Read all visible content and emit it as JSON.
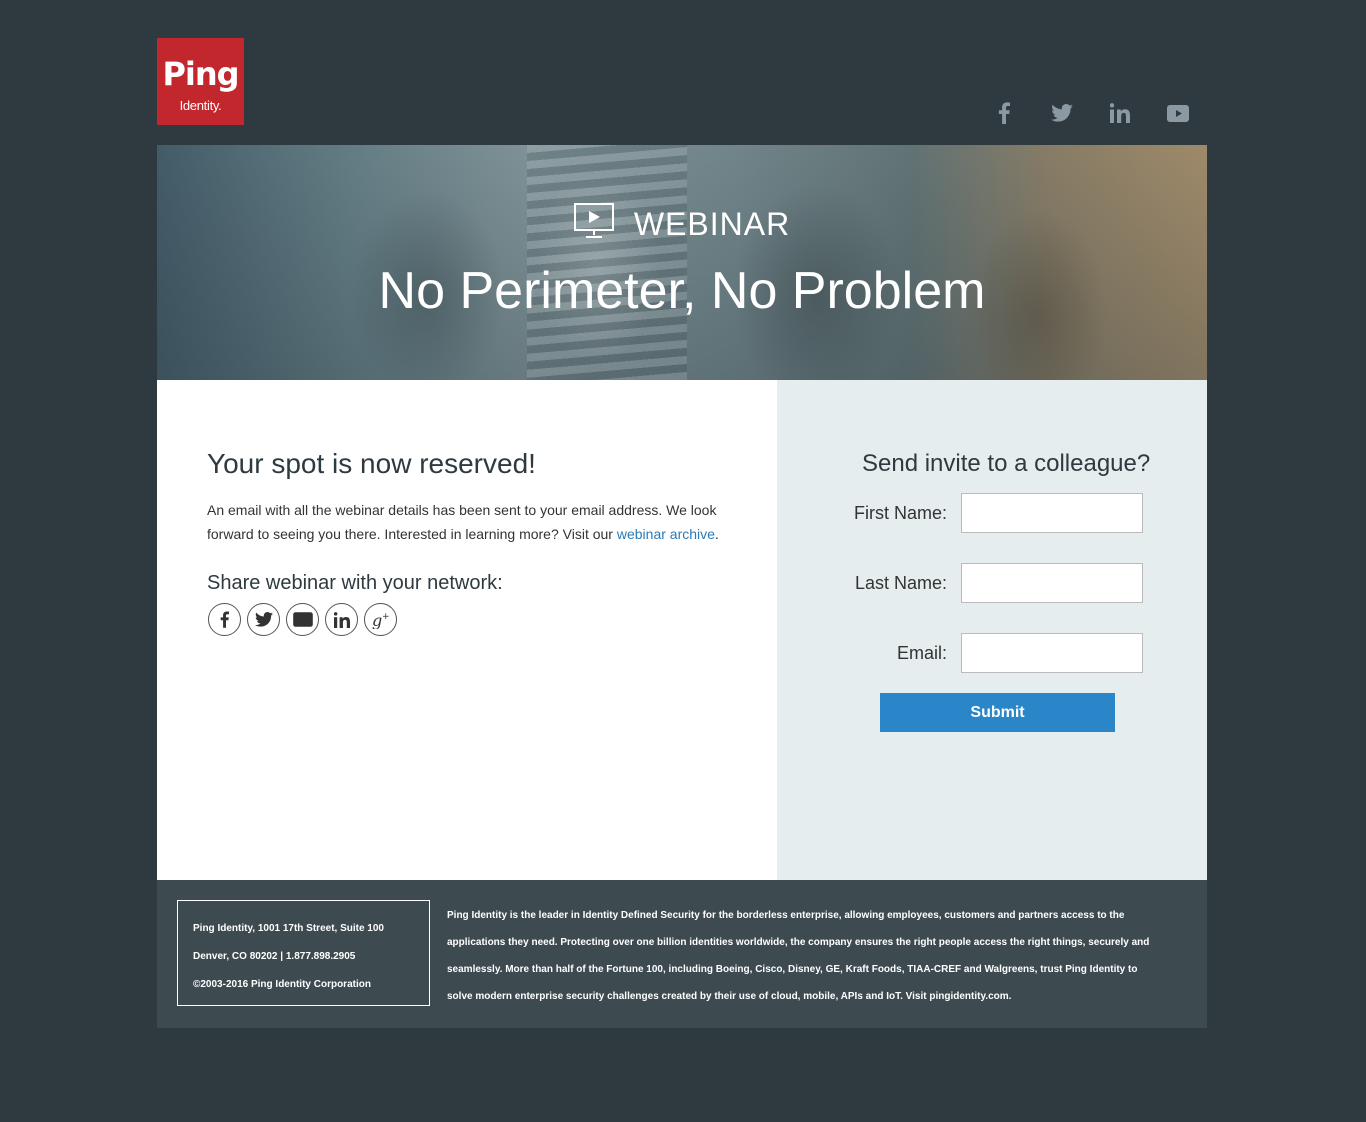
{
  "header": {
    "logo_main": "Ping",
    "logo_sub": "Identity.",
    "social": [
      {
        "icon": "facebook-icon"
      },
      {
        "icon": "twitter-icon"
      },
      {
        "icon": "linkedin-icon"
      },
      {
        "icon": "youtube-icon"
      }
    ]
  },
  "hero": {
    "label": "WEBINAR",
    "title": "No Perimeter, No Problem"
  },
  "confirmation": {
    "heading": "Your spot is now reserved!",
    "body_before_link": "An email with all the webinar details has been sent to your email address. We look forward to seeing you there. Interested in learning more? Visit our ",
    "link_text": "webinar archive",
    "body_after_link": ".",
    "share_title": "Share webinar with your network:",
    "share_icons": [
      "facebook-icon",
      "twitter-icon",
      "email-icon",
      "linkedin-icon",
      "google-plus-icon"
    ]
  },
  "invite": {
    "heading": "Send invite to a colleague?",
    "first_name_label": "First Name:",
    "first_name_value": "",
    "last_name_label": "Last Name:",
    "last_name_value": "",
    "email_label": "Email:",
    "email_value": "",
    "submit_label": "Submit"
  },
  "footer": {
    "address_line1": "Ping Identity, 1001 17th Street, Suite 100",
    "address_line2": "Denver, CO 80202 | 1.877.898.2905",
    "copyright": "©2003-2016 Ping Identity Corporation",
    "about": "Ping Identity is the leader in Identity Defined Security for the borderless enterprise, allowing employees, customers and partners access to the applications they need. Protecting over one billion identities worldwide, the company ensures the right people access the right things, securely and seamlessly. More than half of the Fortune 100, including Boeing, Cisco, Disney, GE, Kraft Foods, TIAA-CREF and Walgreens, trust Ping Identity to solve modern enterprise security challenges created by their use of cloud, mobile, APIs and IoT. Visit pingidentity.com."
  },
  "colors": {
    "page_bg": "#2e3a40",
    "logo_red": "#c1272d",
    "accent_blue": "#2a86c8",
    "link_blue": "#2a7ab8",
    "invite_panel_bg": "#e5edee",
    "footer_bg": "#3d4a50"
  }
}
